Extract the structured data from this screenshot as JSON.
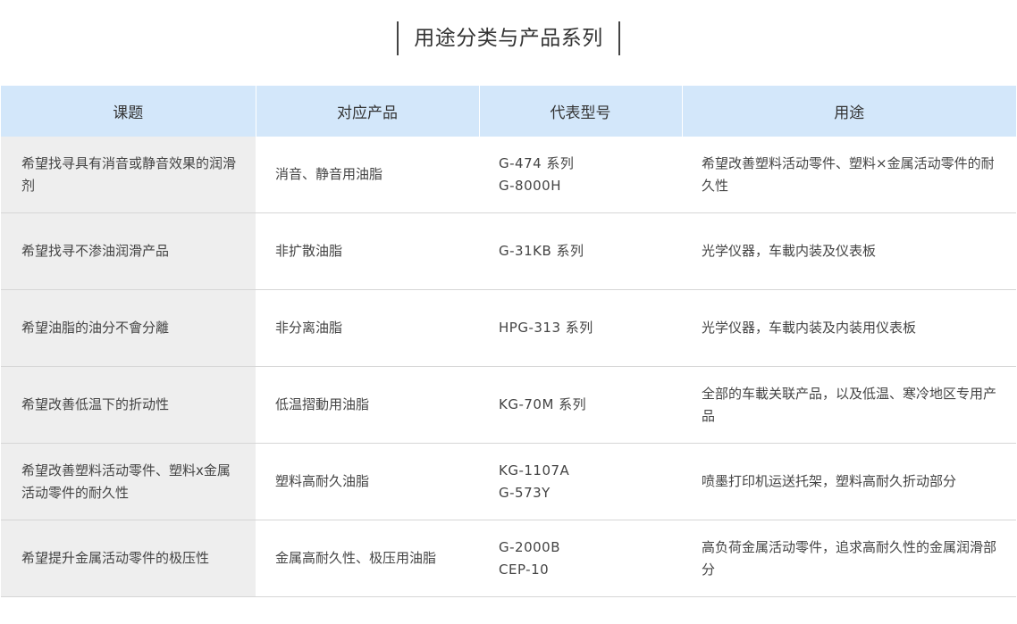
{
  "title": "用途分类与产品系列",
  "table": {
    "headers": [
      "课题",
      "对应产品",
      "代表型号",
      "用途"
    ],
    "rows": [
      {
        "issue": "希望找寻具有消音或静音效果的润滑剂",
        "product": "消音、静音用油脂",
        "models": [
          "G-474 系列",
          "G-8000H"
        ],
        "usage": "希望改善塑料活动零件、塑料×金属活动零件的耐久性"
      },
      {
        "issue": "希望找寻不渗油润滑产品",
        "product": "非扩散油脂",
        "models": [
          "G-31KB 系列"
        ],
        "usage": "光学仪器，车載内装及仪表板"
      },
      {
        "issue": "希望油脂的油分不會分離",
        "product": "非分离油脂",
        "models": [
          "HPG-313 系列"
        ],
        "usage": "光学仪器，车載内装及内装用仪表板"
      },
      {
        "issue": "希望改善低温下的折动性",
        "product": "低温摺動用油脂",
        "models": [
          "KG-70M 系列"
        ],
        "usage": "全部的车載关联产品，以及低温、寒冷地区专用产品"
      },
      {
        "issue": "希望改善塑料活动零件、塑料x金属活动零件的耐久性",
        "product": "塑料高耐久油脂",
        "models": [
          "KG-1107A",
          "G-573Y"
        ],
        "usage": "喷墨打印机运送托架，塑料高耐久折动部分"
      },
      {
        "issue": "希望提升金属活动零件的极压性",
        "product": "金属高耐久性、极压用油脂",
        "models": [
          "G-2000B",
          "CEP-10"
        ],
        "usage": "高负荷金属活动零件，追求高耐久性的金属润滑部分"
      }
    ]
  }
}
